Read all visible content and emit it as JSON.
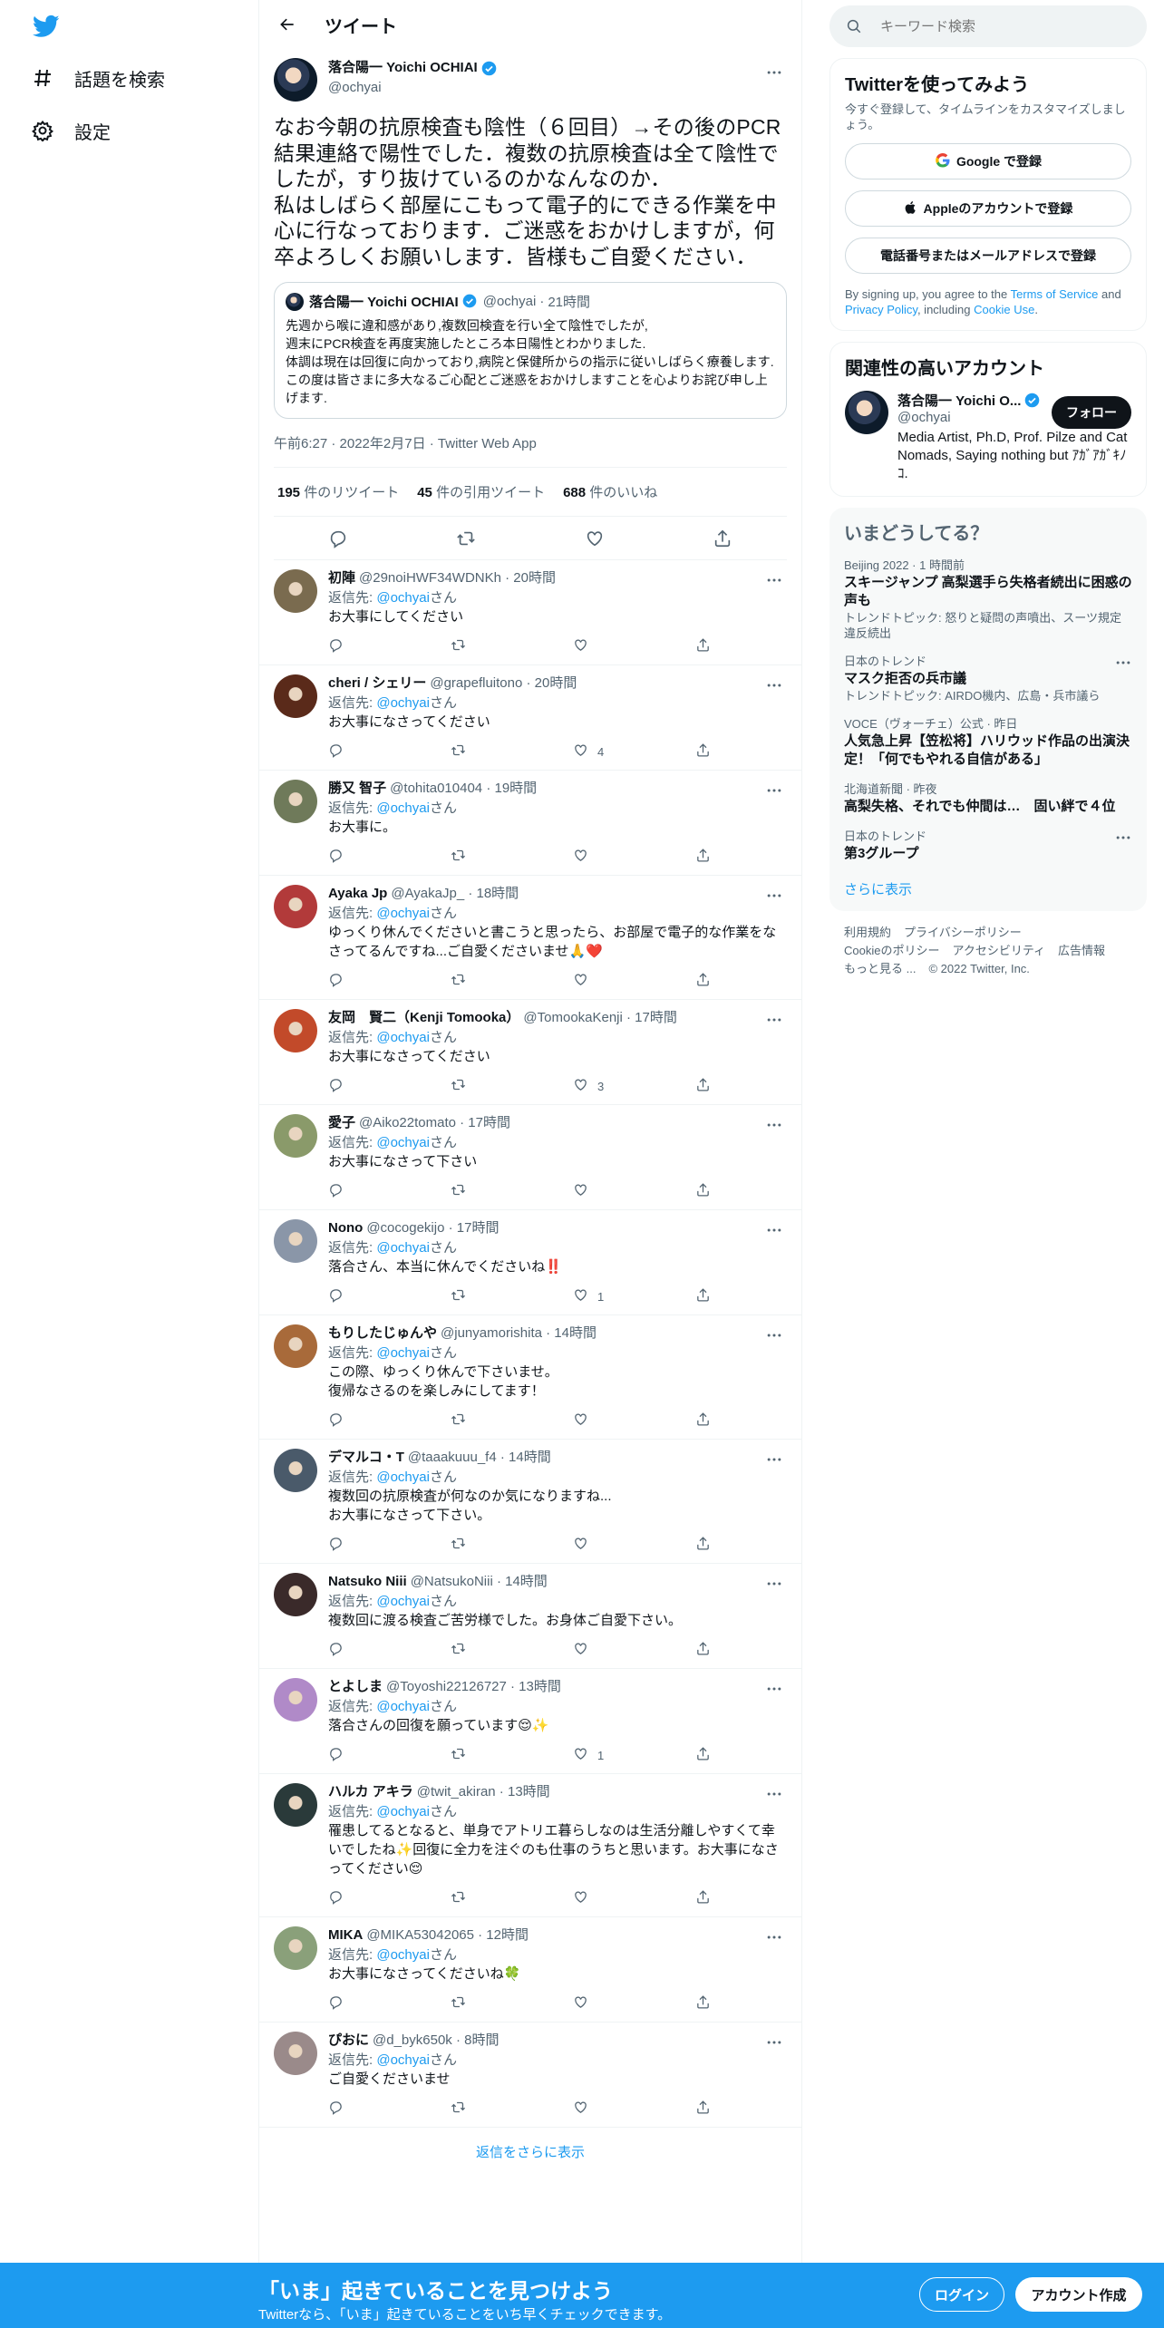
{
  "nav": {
    "explore": "話題を検索",
    "settings": "設定"
  },
  "header": {
    "title": "ツイート"
  },
  "main_tweet": {
    "name": "落合陽一 Yoichi OCHIAI",
    "handle": "@ochyai",
    "text": "なお今朝の抗原検査も陰性（６回目）→その後のPCR結果連絡で陽性でした．複数の抗原検査は全て陰性でしたが，すり抜けているのかなんなのか．\n私はしばらく部屋にこもって電子的にできる作業を中心に行なっております．ご迷惑をおかけしますが，何卒よろしくお願いします．皆様もご自愛ください．",
    "quote": {
      "name": "落合陽一 Yoichi OCHIAI",
      "handle": "@ochyai",
      "time": "21時間",
      "text": "先週から喉に違和感があり,複数回検査を行い全て陰性でしたが,\n週末にPCR検査を再度実施したところ本日陽性とわかりました.\n体調は現在は回復に向かっており,病院と保健所からの指示に従いしばらく療養します.\nこの度は皆さまに多大なるご心配とご迷惑をおかけしますことを心よりお詫び申し上げます."
    },
    "timestamp": "午前6:27 · 2022年2月7日 · Twitter Web App",
    "retweets": "195",
    "retweets_label": "件のリツイート",
    "quotes": "45",
    "quotes_label": "件の引用ツイート",
    "likes": "688",
    "likes_label": "件のいいね"
  },
  "reply_to_label": "返信先:",
  "reply_to_handle": "@ochyai",
  "reply_to_suffix": "さん",
  "replies": [
    {
      "name": "初陣",
      "meta": "@29noiHWF34WDNKh · 20時間",
      "text": "お大事にしてください",
      "likes": "",
      "color": "#7a6b4f"
    },
    {
      "name": "cheri / シェリー",
      "meta": "@grapefluitono · 20時間",
      "text": "お大事になさってください",
      "likes": "4",
      "color": "#5a2a1a"
    },
    {
      "name": "勝又 智子",
      "meta": "@tohita010404 · 19時間",
      "text": "お大事に。",
      "likes": "",
      "color": "#6f7a5a"
    },
    {
      "name": "Ayaka Jp",
      "meta": "@AyakaJp_ · 18時間",
      "text": "ゆっくり休んでくださいと書こうと思ったら、お部屋で電子的な作業をなさってるんですね...ご自愛くださいませ🙏❤️",
      "likes": "",
      "color": "#b23a3a"
    },
    {
      "name": "友岡　賢二（Kenji Tomooka）",
      "meta": "@TomookaKenji · 17時間",
      "text": "お大事になさってください",
      "likes": "3",
      "color": "#c24a2a"
    },
    {
      "name": "愛子",
      "meta": "@Aiko22tomato · 17時間",
      "text": "お大事になさって下さい",
      "likes": "",
      "color": "#8a9a6a"
    },
    {
      "name": "Nono",
      "meta": "@cocogekijo · 17時間",
      "text": "落合さん、本当に休んでくださいね‼️",
      "likes": "1",
      "color": "#8a96a8"
    },
    {
      "name": "もりしたじゅんや",
      "meta": "@junyamorishita · 14時間",
      "text": "この際、ゆっくり休んで下さいませ。\n復帰なさるのを楽しみにしてます！",
      "likes": "",
      "color": "#a86a3a"
    },
    {
      "name": "デマルコ・T",
      "meta": "@taaakuuu_f4 · 14時間",
      "text": "複数回の抗原検査が何なのか気になりますね...\nお大事になさって下さい。",
      "likes": "",
      "color": "#4a5a6a"
    },
    {
      "name": "Natsuko Niii",
      "meta": "@NatsukoNiii · 14時間",
      "text": "複数回に渡る検査ご苦労様でした。お身体ご自愛下さい。",
      "likes": "",
      "color": "#3a2a2a"
    },
    {
      "name": "とよしま",
      "meta": "@Toyoshi22126727 · 13時間",
      "text": "落合さんの回復を願っています😌✨",
      "likes": "1",
      "color": "#b08ac8"
    },
    {
      "name": "ハルカ アキラ",
      "meta": "@twit_akiran · 13時間",
      "text": "罹患してるとなると、単身でアトリエ暮らしなのは生活分離しやすくて幸いでしたね✨回復に全力を注ぐのも仕事のうちと思います。お大事になさってください😌",
      "likes": "",
      "color": "#2a3a3a"
    },
    {
      "name": "MIKA",
      "meta": "@MIKA53042065 · 12時間",
      "text": "お大事になさってくださいね🍀",
      "likes": "",
      "color": "#8aa07a"
    },
    {
      "name": "ぴおに",
      "meta": "@d_byk650k · 8時間",
      "text": "ご自愛くださいませ",
      "likes": "",
      "color": "#9a8a8a"
    }
  ],
  "show_more_replies": "返信をさらに表示",
  "right": {
    "search_placeholder": "キーワード検索",
    "signup": {
      "title": "Twitterを使ってみよう",
      "subtitle": "今すぐ登録して、タイムラインをカスタマイズしましょう。",
      "google": "Google で登録",
      "apple": "Appleのアカウントで登録",
      "phone": "電話番号またはメールアドレスで登録",
      "terms_1": "By signing up, you agree to the ",
      "terms_link_1": "Terms of Service",
      "terms_2": " and ",
      "terms_link_2": "Privacy Policy",
      "terms_3": ", including ",
      "terms_link_3": "Cookie Use",
      "terms_4": "."
    },
    "related": {
      "title": "関連性の高いアカウント",
      "name": "落合陽一 Yoichi O...",
      "handle": "@ochyai",
      "bio": "Media Artist, Ph.D, Prof. Pilze and Cat Nomads, Saying nothing but ｱｶﾞｱｶﾞｷﾉｺ.",
      "follow": "フォロー"
    },
    "trends": {
      "title": "いまどうしてる？",
      "items": [
        {
          "ctx": "Beijing 2022 · 1 時間前",
          "title": "スキージャンプ 高梨選手ら失格者続出に困惑の声も",
          "sub": "トレンドトピック: 怒りと疑問の声噴出、スーツ規定違反続出"
        },
        {
          "ctx": "日本のトレンド",
          "title": "マスク拒否の兵市議",
          "sub": "トレンドトピック: AIRDO機内、広島・兵市議ら"
        },
        {
          "ctx": "VOCE（ヴォーチェ）公式 · 昨日",
          "title": "人気急上昇【笠松将】ハリウッド作品の出演決定！「何でもやれる自信がある」",
          "sub": ""
        },
        {
          "ctx": "北海道新聞 · 昨夜",
          "title": "高梨失格、それでも仲間は…　固い絆で４位",
          "sub": ""
        },
        {
          "ctx": "日本のトレンド",
          "title": "第3グループ",
          "sub": ""
        }
      ],
      "more": "さらに表示"
    },
    "footer": [
      "利用規約",
      "プライバシーポリシー",
      "Cookieのポリシー",
      "アクセシビリティ",
      "広告情報",
      "もっと見る ...",
      "© 2022 Twitter, Inc."
    ]
  },
  "bottombar": {
    "title": "「いま」起きていることを見つけよう",
    "subtitle": "Twitterなら、「いま」起きていることをいち早くチェックできます。",
    "login": "ログイン",
    "signup": "アカウント作成"
  },
  "colors": {
    "accent": "#1d9bf0",
    "text": "#0f1419",
    "secondary": "#536471"
  }
}
